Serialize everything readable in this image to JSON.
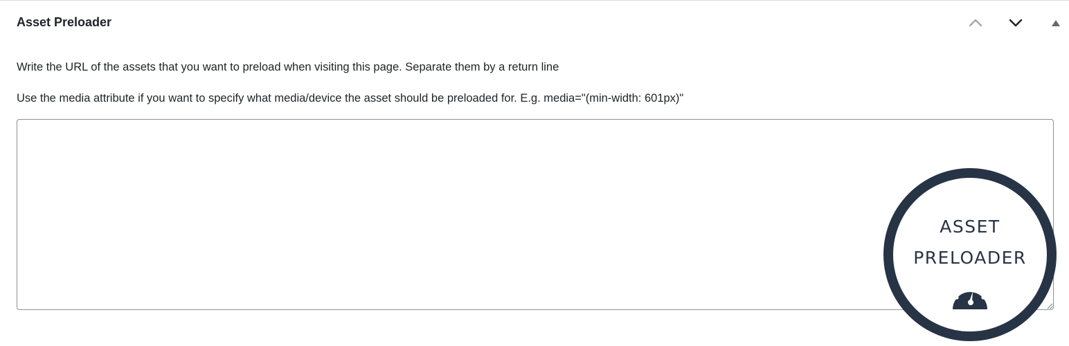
{
  "metabox": {
    "title": "Asset Preloader",
    "buttons": {
      "move_up_icon": "chevron-up-icon",
      "move_down_icon": "chevron-down-icon",
      "toggle_icon": "triangle-up-icon"
    }
  },
  "description": {
    "line1": "Write the URL of the assets that you want to preload when visiting this page. Separate them by a return line",
    "line2": "Use the media attribute if you want to specify what media/device the asset should be preloaded for. E.g. media=\"(min-width: 601px)\""
  },
  "textarea": {
    "value": ""
  },
  "logo": {
    "line1": "ASSET",
    "line2": "PRELOADER",
    "icon": "speedometer-icon",
    "color": "#263445"
  },
  "colors": {
    "text": "#1d2327",
    "border": "#8c8f94",
    "muted_icon": "#a7aaad"
  }
}
